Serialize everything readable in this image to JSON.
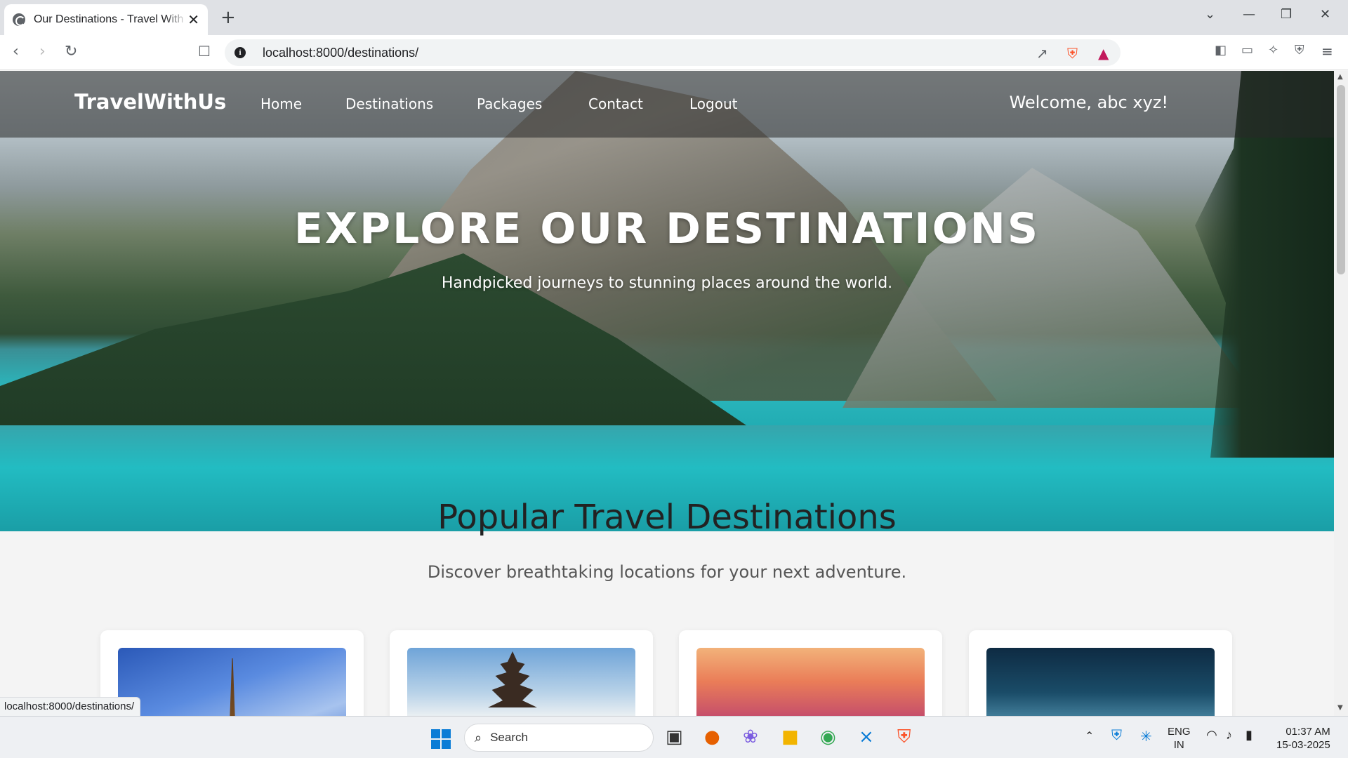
{
  "browser": {
    "tab_title": "Our Destinations - Travel With Us",
    "tab_close": "✕",
    "new_tab": "+",
    "url": "localhost:8000/destinations/",
    "status_url": "localhost:8000/destinations/",
    "window_controls": {
      "minimize": "—",
      "restore": "❐",
      "close": "✕",
      "tab_search": "⌄"
    }
  },
  "site": {
    "brand": "TravelWithUs",
    "nav": [
      "Home",
      "Destinations",
      "Packages",
      "Contact",
      "Logout"
    ],
    "welcome": "Welcome, abc xyz!"
  },
  "hero": {
    "title": "EXPLORE OUR DESTINATIONS",
    "subtitle": "Handpicked journeys to stunning places around the world."
  },
  "section": {
    "title": "Popular Travel Destinations",
    "subtitle": "Discover breathtaking locations for your next adventure."
  },
  "cards": [
    {
      "icon": "eiffel-tower-photo"
    },
    {
      "icon": "bali-temple-photo"
    },
    {
      "icon": "sunset-city-photo"
    },
    {
      "icon": "tokyo-skyline-photo"
    }
  ],
  "taskbar": {
    "search_placeholder": "Search",
    "lang_line1": "ENG",
    "lang_line2": "IN",
    "time": "01:37 AM",
    "date": "15-03-2025"
  },
  "colors": {
    "accent": "#0a7cd6",
    "brave": "#fb542b",
    "nav_overlay": "rgba(40,40,40,0.55)"
  }
}
